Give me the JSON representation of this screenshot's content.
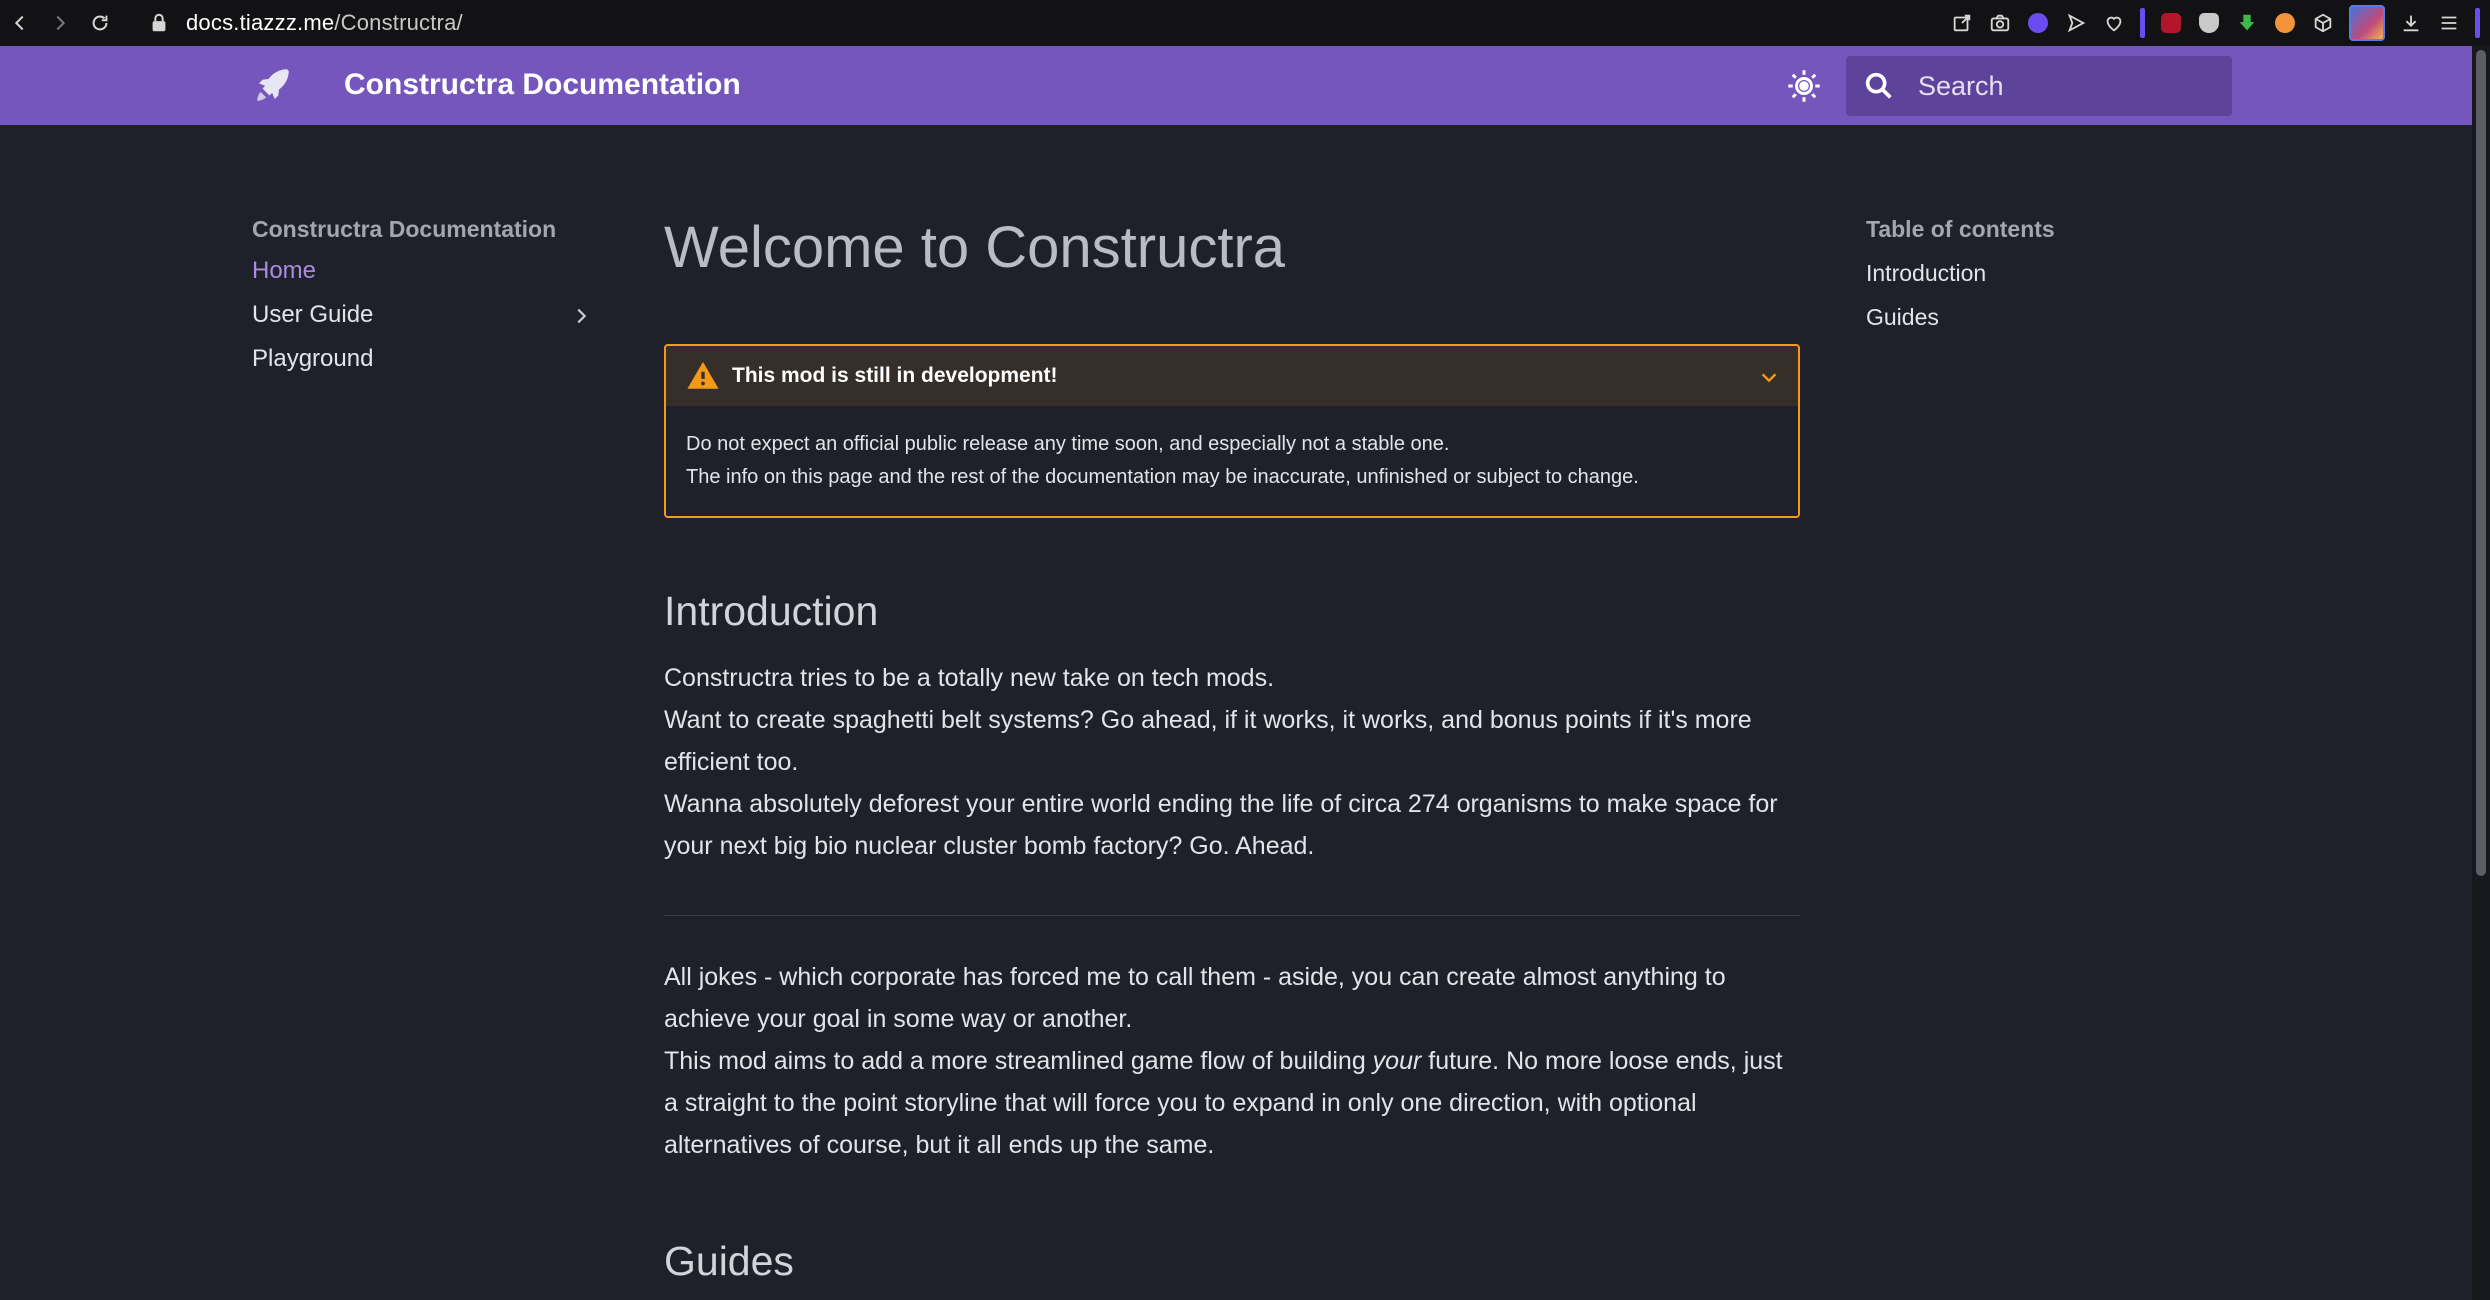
{
  "browser": {
    "url_host": "docs.tiazzz.me",
    "url_path": "/Constructra/"
  },
  "header": {
    "site_title": "Constructra Documentation",
    "search_placeholder": "Search"
  },
  "sidebar": {
    "heading": "Constructra Documentation",
    "items": [
      {
        "label": "Home"
      },
      {
        "label": "User Guide"
      },
      {
        "label": "Playground"
      }
    ]
  },
  "main": {
    "title": "Welcome to Constructra",
    "admonition": {
      "title": "This mod is still in development!",
      "line1": "Do not expect an official public release any time soon, and especially not a stable one.",
      "line2": "The info on this page and the rest of the documentation may be inaccurate, unfinished or subject to change."
    },
    "intro_heading": "Introduction",
    "intro_p1": "Constructra tries to be a totally new take on tech mods.",
    "intro_p2": "Want to create spaghetti belt systems? Go ahead, if it works, it works, and bonus points if it's more efficient too.",
    "intro_p3": "Wanna absolutely deforest your entire world ending the life of circa 274 organisms to make space for your next big bio nuclear cluster bomb factory? Go. Ahead.",
    "jokes_p1": "All jokes - which corporate has forced me to call them - aside, you can create almost anything to achieve your goal in some way or another.",
    "aims_before": "This mod aims to add a more streamlined game flow of building ",
    "aims_em": "your",
    "aims_after": " future. No more loose ends, just a straight to the point storyline that will force you to expand in only one direction, with optional alternatives of course, but it all ends up the same.",
    "guides_heading": "Guides"
  },
  "toc": {
    "heading": "Table of contents",
    "items": [
      {
        "label": "Introduction"
      },
      {
        "label": "Guides"
      }
    ]
  },
  "colors": {
    "header_bg": "#7556bd",
    "page_bg": "#1e2129",
    "accent": "#a98be0",
    "warning": "#f49a18"
  }
}
